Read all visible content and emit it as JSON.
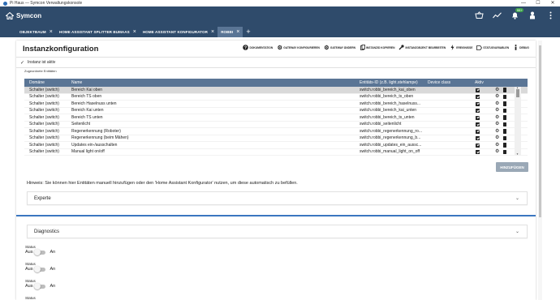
{
  "window": {
    "title": "Pi Haus — Symcon Verwaltungskonsole",
    "controls": [
      "—",
      "☐",
      "✕"
    ]
  },
  "app": {
    "brand": "Symcon",
    "notification_count": "99+"
  },
  "tabs": [
    {
      "label": "OBJEKTBAUM",
      "active": false
    },
    {
      "label": "HOME ASSISTANT SPLITTER BUMAAS",
      "active": false
    },
    {
      "label": "HOME ASSISTANT KONFIGURATOR",
      "active": false
    },
    {
      "label": "ROBBI",
      "active": true
    }
  ],
  "tab_add": "+",
  "page": {
    "title": "Instanzkonfiguration"
  },
  "actions": [
    {
      "label": "DOKUMENTATION",
      "icon": "question-icon"
    },
    {
      "label": "GATEWAY KONFIGURIEREN",
      "icon": "gear-icon"
    },
    {
      "label": "GATEWAY ÄNDERN",
      "icon": "gear-icon"
    },
    {
      "label": "INSTANZID KOPIEREN",
      "icon": "copy-icon"
    },
    {
      "label": "INSTANZOBJEKT BEARBEITEN",
      "icon": "wrench-icon"
    },
    {
      "label": "EREIGNISSE",
      "icon": "lightning-icon"
    },
    {
      "label": "STATUSVARIABLEN",
      "icon": "tag-icon"
    },
    {
      "label": "DEBUG",
      "icon": "info-icon"
    }
  ],
  "status": {
    "text": "Instanz ist aktiv"
  },
  "table": {
    "label": "Zugeordnete Entitäten",
    "columns": {
      "domain": "Domäne",
      "name": "Name",
      "entity_id": "Entitäts-ID (z.B. light.stehlampe)",
      "device_class": "Device class",
      "active": "Aktiv"
    },
    "rows": [
      {
        "domain": "Schalter (switch)",
        "name": "Bereich Kai oben",
        "entity_id": "switch.robbi_bereich_kai_oben",
        "active": true,
        "selected": true
      },
      {
        "domain": "Schalter (switch)",
        "name": "Bereich TS oben",
        "entity_id": "switch.robbi_bereich_ts_oben",
        "active": true,
        "selected": false
      },
      {
        "domain": "Schalter (switch)",
        "name": "Bereich Haselnuss unten",
        "entity_id": "switch.robbi_bereich_haselnuss...",
        "active": true,
        "selected": false
      },
      {
        "domain": "Schalter (switch)",
        "name": "Bereich Kai unten",
        "entity_id": "switch.robbi_bereich_kai_unten",
        "active": true,
        "selected": false
      },
      {
        "domain": "Schalter (switch)",
        "name": "Bereich TS unten",
        "entity_id": "switch.robbi_bereich_ts_unten",
        "active": true,
        "selected": false
      },
      {
        "domain": "Schalter (switch)",
        "name": "Seitenlicht",
        "entity_id": "switch.robbi_seitenlicht",
        "active": true,
        "selected": false
      },
      {
        "domain": "Schalter (switch)",
        "name": "Regenerkennung (Roboter)",
        "entity_id": "switch.robbi_regenerkennung_ro...",
        "active": true,
        "selected": false
      },
      {
        "domain": "Schalter (switch)",
        "name": "Regenerkennung (beim Mähen)",
        "entity_id": "switch.robbi_regenerkennung_b...",
        "active": true,
        "selected": false
      },
      {
        "domain": "Schalter (switch)",
        "name": "Updates ein-/ausschalten",
        "entity_id": "switch.robbi_updates_ein_aussc...",
        "active": true,
        "selected": false
      },
      {
        "domain": "Schalter (switch)",
        "name": "Manual light on/off",
        "entity_id": "switch.robbi_manual_light_on_off",
        "active": true,
        "selected": false
      }
    ]
  },
  "add_button": "HINZUFÜGEN",
  "hint": "Hinweis: Sie können hier Entitäten manuell hinzufügen oder den 'Home Assistant Konfigurator' nutzen, um diese automatisch zu befüllen.",
  "expanders": {
    "experts": "Experte",
    "diagnostics": "Diagnostics"
  },
  "diagnostics": {
    "items": [
      {
        "label": "Status",
        "off": "Aus",
        "on": "An"
      },
      {
        "label": "Status",
        "off": "Aus",
        "on": "An"
      },
      {
        "label": "Status",
        "off": "Aus",
        "on": "An"
      },
      {
        "label": "Status"
      }
    ]
  },
  "colors": {
    "topbar": "#2f4b6b",
    "active_tab": "#5a7595",
    "table_header": "#5a7595",
    "accent_line": "#3b76c0",
    "badge": "#3fa34d"
  }
}
